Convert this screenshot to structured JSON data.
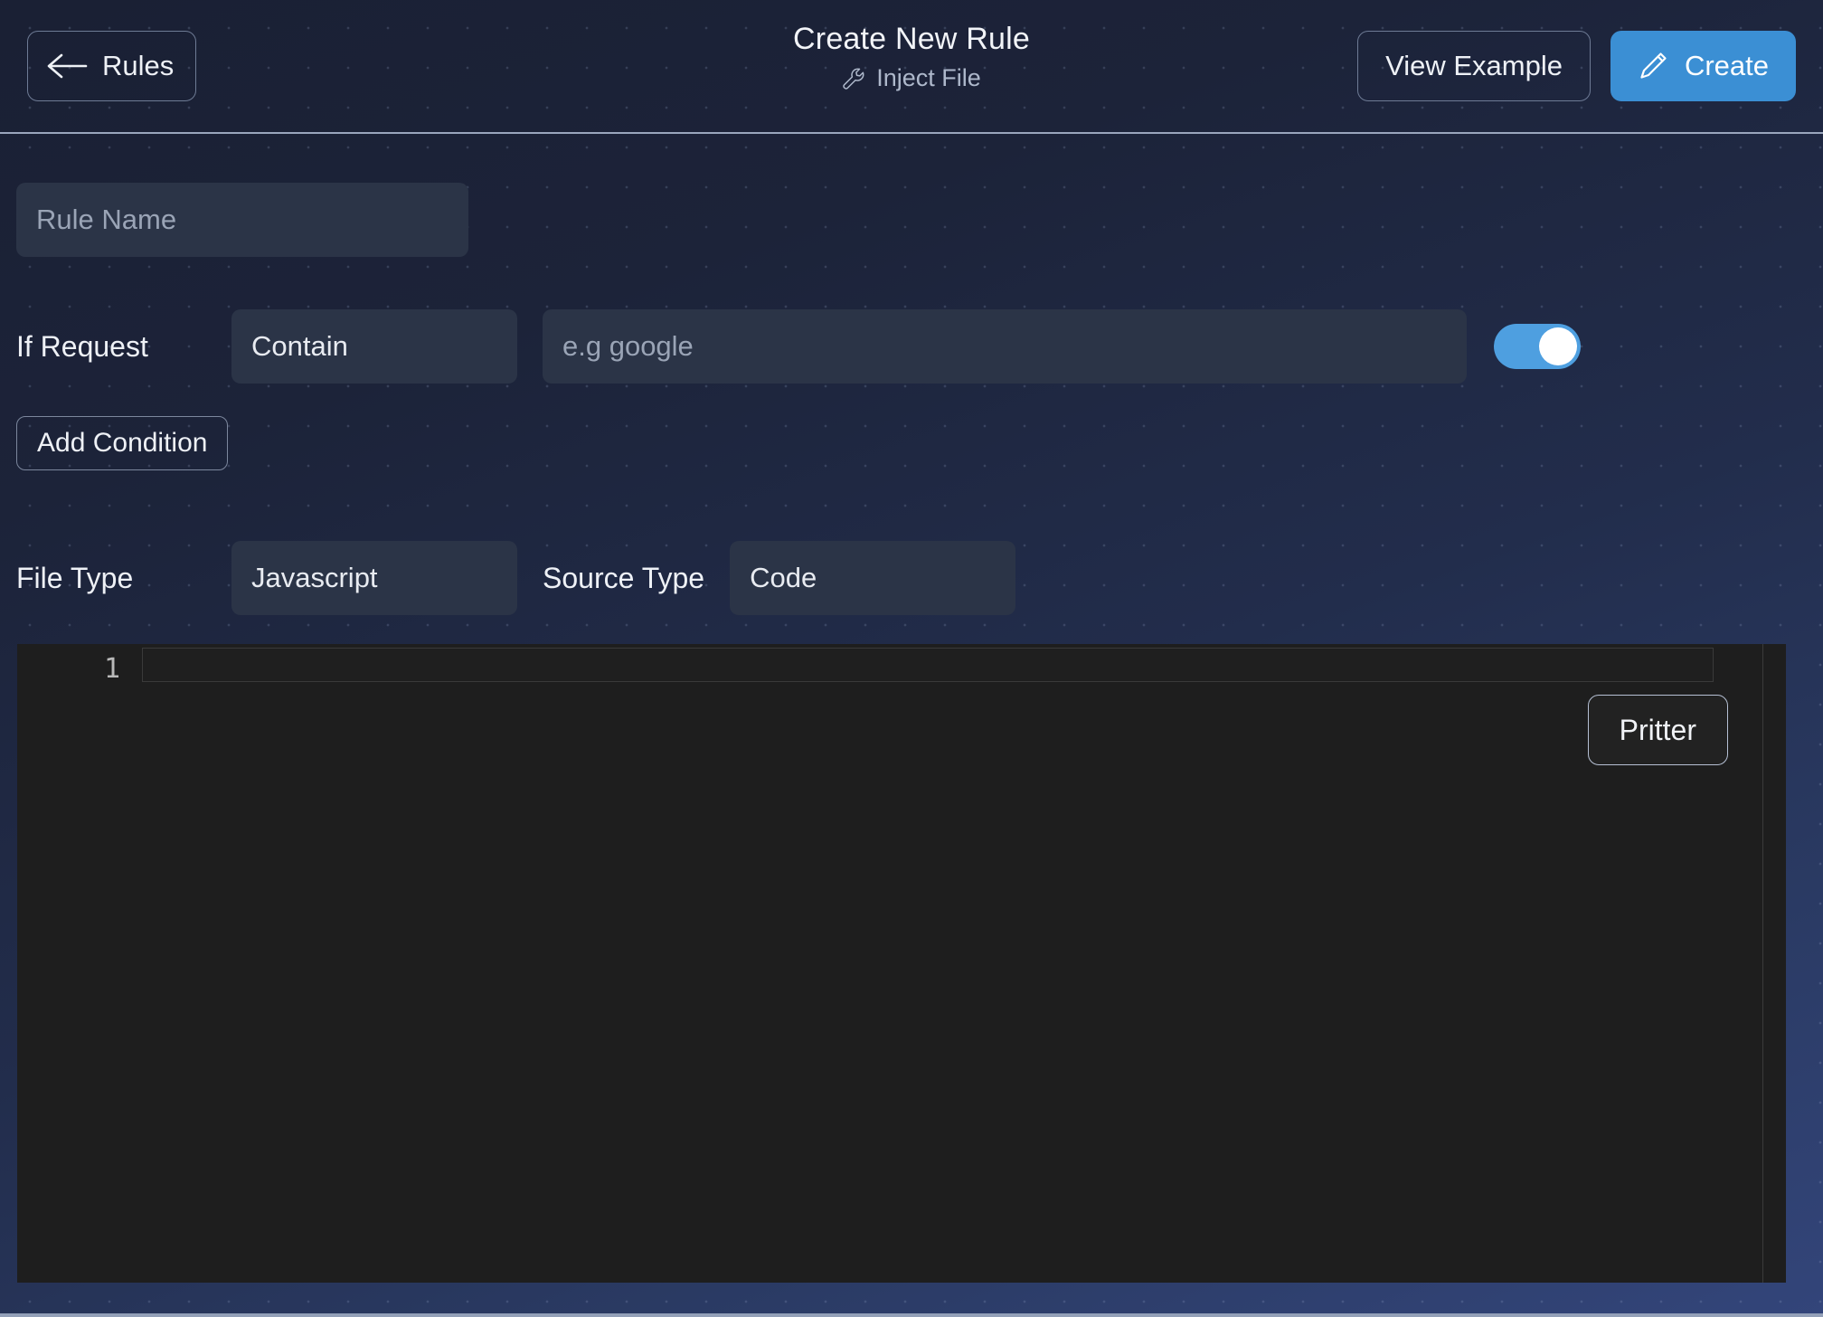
{
  "header": {
    "back_label": "Rules",
    "back_icon": "arrow-left-icon",
    "title": "Create New Rule",
    "subtitle": "Inject File",
    "subtitle_icon": "wrench-icon",
    "view_example_label": "View Example",
    "create_label": "Create",
    "create_icon": "pencil-icon",
    "accent_color": "#3b8fd4"
  },
  "form": {
    "rule_name": {
      "placeholder": "Rule Name",
      "value": ""
    },
    "condition": {
      "label": "If Request",
      "operator": "Contain",
      "value_placeholder": "e.g google",
      "value": "",
      "enabled": true,
      "toggle_color": "#4e9fe0"
    },
    "add_condition_label": "Add Condition",
    "file_type": {
      "label": "File Type",
      "value": "Javascript"
    },
    "source_type": {
      "label": "Source Type",
      "value": "Code"
    }
  },
  "editor": {
    "line_numbers": [
      "1"
    ],
    "content": "",
    "format_button_label": "Pritter",
    "background_color": "#1e1e1e"
  }
}
